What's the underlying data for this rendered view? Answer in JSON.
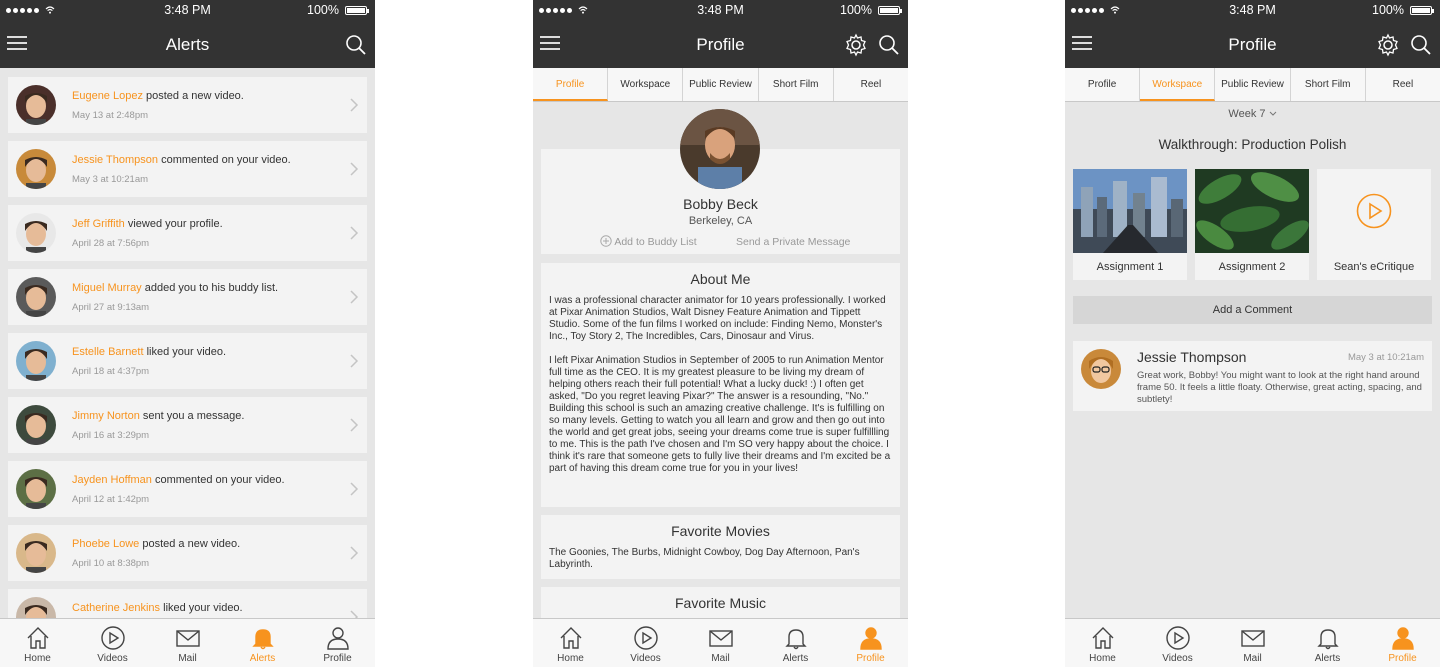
{
  "colors": {
    "accent": "#f7931e",
    "bar": "#333333",
    "bg": "#e6e6e6",
    "card": "#f3f3f3"
  },
  "status": {
    "time": "3:48 PM",
    "battery": "100%"
  },
  "tabbar": [
    {
      "label": "Home",
      "icon": "home-icon"
    },
    {
      "label": "Videos",
      "icon": "play-icon"
    },
    {
      "label": "Mail",
      "icon": "mail-icon"
    },
    {
      "label": "Alerts",
      "icon": "bell-icon"
    },
    {
      "label": "Profile",
      "icon": "person-icon"
    }
  ],
  "alerts_screen": {
    "title": "Alerts",
    "items": [
      {
        "who": "Eugene Lopez",
        "action": " posted a new video.",
        "date": "May 13 at 2:48pm"
      },
      {
        "who": "Jessie Thompson",
        "action": " commented on your video.",
        "date": "May 3 at 10:21am"
      },
      {
        "who": "Jeff Griffith",
        "action": " viewed your profile.",
        "date": "April 28 at 7:56pm"
      },
      {
        "who": "Miguel Murray",
        "action": " added you to his buddy list.",
        "date": "April 27 at 9:13am"
      },
      {
        "who": "Estelle Barnett",
        "action": " liked your video.",
        "date": "April 18 at 4:37pm"
      },
      {
        "who": "Jimmy Norton",
        "action": " sent you a message.",
        "date": "April 16 at 3:29pm"
      },
      {
        "who": "Jayden Hoffman",
        "action": " commented on your video.",
        "date": "April 12 at 1:42pm"
      },
      {
        "who": "Phoebe Lowe",
        "action": " posted a new video.",
        "date": "April 10 at 8:38pm"
      },
      {
        "who": "Catherine Jenkins",
        "action": " liked your video.",
        "date": ""
      }
    ]
  },
  "profile_screen": {
    "title": "Profile",
    "tabs": [
      "Profile",
      "Workspace",
      "Public Review",
      "Short Film",
      "Reel"
    ],
    "name": "Bobby Beck",
    "location": "Berkeley, CA",
    "add_buddy": "Add to Buddy List",
    "private_msg": "Send a Private Message",
    "about_title": "About Me",
    "about_p1": "I was a professional character animator for 10 years professionally. I worked at Pixar Animation Studios, Walt Disney Feature Animation and Tippett Studio. Some of the fun films I worked on include: Finding Nemo, Monster's Inc., Toy Story 2, The Incredibles, Cars, Dinosaur and Virus.",
    "about_p2": "I left Pixar Animation Studios in September of 2005 to run Animation Mentor full time as the CEO. It is my greatest pleasure to be living my dream of helping others reach their full potential! What a lucky duck! :) I often get asked, \"Do you regret leaving Pixar?\" The answer is a resounding, \"No.\" Building this school is such an amazing creative challenge. It's is fulfilling on so many levels. Getting to watch you all learn and grow and then go out into the world and get great jobs, seeing your dreams come true is super fulfillling to me. This is the path I've chosen and I'm SO very happy about the choice. I think it's rare that someone gets to fully live their dreams and I'm excited be a part of having this dream come true for you in your lives!",
    "movies_title": "Favorite Movies",
    "movies": "The Goonies, The Burbs, Midnight Cowboy, Dog Day Afternoon, Pan's Labyrinth.",
    "music_title": "Favorite Music"
  },
  "workspace_screen": {
    "title": "Profile",
    "tabs": [
      "Profile",
      "Workspace",
      "Public Review",
      "Short Film",
      "Reel"
    ],
    "week": "Week 7",
    "walkthrough": "Walkthrough: Production Polish",
    "thumbs": [
      "Assignment 1",
      "Assignment 2",
      "Sean's eCritique"
    ],
    "add_comment": "Add a Comment",
    "comment": {
      "name": "Jessie Thompson",
      "time": "May 3 at 10:21am",
      "body": "Great work, Bobby! You might want to look at the right hand around frame 50. It feels a little floaty. Otherwise, great acting, spacing, and subtlety!"
    }
  }
}
